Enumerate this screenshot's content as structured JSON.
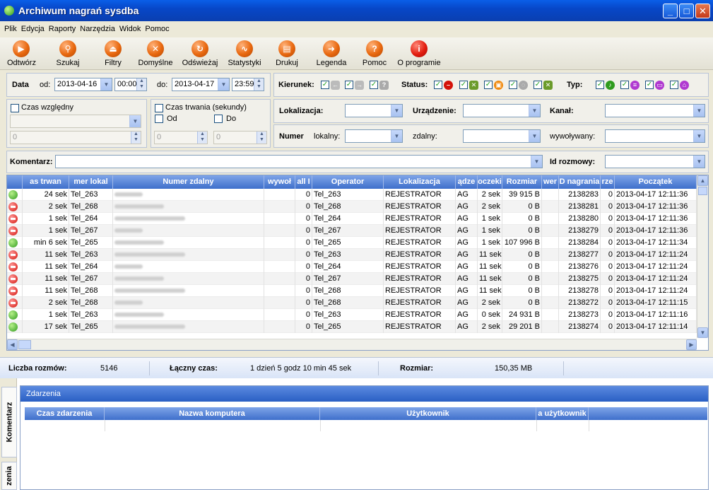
{
  "window": {
    "title": "Archiwum nagrań sysdba"
  },
  "menu": [
    "Plik",
    "Edycja",
    "Raporty",
    "Narzędzia",
    "Widok",
    "Pomoc"
  ],
  "toolbar": [
    {
      "label": "Odtwórz",
      "icon": "play-icon"
    },
    {
      "label": "Szukaj",
      "icon": "search-icon"
    },
    {
      "label": "Filtry",
      "icon": "filter-icon"
    },
    {
      "label": "Domyślne",
      "icon": "defaults-icon"
    },
    {
      "label": "Odświeżaj",
      "icon": "refresh-icon"
    },
    {
      "label": "Statystyki",
      "icon": "stats-icon"
    },
    {
      "label": "Drukuj",
      "icon": "print-icon"
    },
    {
      "label": "Legenda",
      "icon": "legend-icon"
    },
    {
      "label": "Pomoc",
      "icon": "help-icon"
    },
    {
      "label": "O programie",
      "icon": "info-icon"
    }
  ],
  "filters": {
    "data_label": "Data",
    "od_label": "od:",
    "date_from": "2013-04-16",
    "time_from": "00:00",
    "do_label": "do:",
    "date_to": "2013-04-17",
    "time_to": "23:59",
    "kierunek_label": "Kierunek:",
    "status_label": "Status:",
    "typ_label": "Typ:",
    "czas_wzgledny": "Czas względny",
    "czas_trwania": "Czas trwania (sekundy)",
    "od_small": "Od",
    "do_small": "Do",
    "rel_value": "0",
    "dur_from": "0",
    "dur_to": "0",
    "lokalizacja_label": "Lokalizacja:",
    "urzadzenie_label": "Urządzenie:",
    "kanal_label": "Kanał:",
    "numer_label": "Numer",
    "lokalny_label": "lokalny:",
    "zdalny_label": "zdalny:",
    "wywolywany_label": "wywoływany:",
    "komentarz_label": "Komentarz:",
    "id_rozmowy_label": "Id rozmowy:"
  },
  "table": {
    "headers": [
      "",
      "as trwan",
      "mer lokal",
      "Numer zdalny",
      "wywoł",
      "all I",
      "Operator",
      "Lokalizacja",
      "ądze",
      "oczeki",
      "Rozmiar",
      "wer",
      "D nagrania",
      "rze",
      "Początek"
    ],
    "rows": [
      {
        "status": "ok",
        "cells": [
          "24 sek",
          "Tel_263",
          "",
          "",
          "0",
          "Tel_263",
          "REJESTRATOR",
          "AG",
          "2 sek",
          "39 915 B",
          "",
          "2138283",
          "0",
          "2013-04-17 12:11:36"
        ]
      },
      {
        "status": "no",
        "cells": [
          "2 sek",
          "Tel_268",
          "",
          "",
          "0",
          "Tel_268",
          "REJESTRATOR",
          "AG",
          "2 sek",
          "0 B",
          "",
          "2138281",
          "0",
          "2013-04-17 12:11:36"
        ]
      },
      {
        "status": "no",
        "cells": [
          "1 sek",
          "Tel_264",
          "",
          "",
          "0",
          "Tel_264",
          "REJESTRATOR",
          "AG",
          "1 sek",
          "0 B",
          "",
          "2138280",
          "0",
          "2013-04-17 12:11:36"
        ]
      },
      {
        "status": "no",
        "cells": [
          "1 sek",
          "Tel_267",
          "",
          "",
          "0",
          "Tel_267",
          "REJESTRATOR",
          "AG",
          "1 sek",
          "0 B",
          "",
          "2138279",
          "0",
          "2013-04-17 12:11:36"
        ]
      },
      {
        "status": "ok",
        "cells": [
          "min 6 sek",
          "Tel_265",
          "",
          "",
          "0",
          "Tel_265",
          "REJESTRATOR",
          "AG",
          "1 sek",
          "107 996 B",
          "",
          "2138284",
          "0",
          "2013-04-17 12:11:34"
        ]
      },
      {
        "status": "no",
        "cells": [
          "11 sek",
          "Tel_263",
          "",
          "",
          "0",
          "Tel_263",
          "REJESTRATOR",
          "AG",
          "11 sek",
          "0 B",
          "",
          "2138277",
          "0",
          "2013-04-17 12:11:24"
        ]
      },
      {
        "status": "no",
        "cells": [
          "11 sek",
          "Tel_264",
          "",
          "",
          "0",
          "Tel_264",
          "REJESTRATOR",
          "AG",
          "11 sek",
          "0 B",
          "",
          "2138276",
          "0",
          "2013-04-17 12:11:24"
        ]
      },
      {
        "status": "no",
        "cells": [
          "11 sek",
          "Tel_267",
          "",
          "",
          "0",
          "Tel_267",
          "REJESTRATOR",
          "AG",
          "11 sek",
          "0 B",
          "",
          "2138275",
          "0",
          "2013-04-17 12:11:24"
        ]
      },
      {
        "status": "no",
        "cells": [
          "11 sek",
          "Tel_268",
          "",
          "",
          "0",
          "Tel_268",
          "REJESTRATOR",
          "AG",
          "11 sek",
          "0 B",
          "",
          "2138278",
          "0",
          "2013-04-17 12:11:24"
        ]
      },
      {
        "status": "no",
        "cells": [
          "2 sek",
          "Tel_268",
          "",
          "",
          "0",
          "Tel_268",
          "REJESTRATOR",
          "AG",
          "2 sek",
          "0 B",
          "",
          "2138272",
          "0",
          "2013-04-17 12:11:15"
        ]
      },
      {
        "status": "ok",
        "cells": [
          "1 sek",
          "Tel_263",
          "",
          "",
          "0",
          "Tel_263",
          "REJESTRATOR",
          "AG",
          "0 sek",
          "24 931 B",
          "",
          "2138273",
          "0",
          "2013-04-17 12:11:16"
        ]
      },
      {
        "status": "ok",
        "cells": [
          "17 sek",
          "Tel_265",
          "",
          "",
          "0",
          "Tel_265",
          "REJESTRATOR",
          "AG",
          "2 sek",
          "29 201 B",
          "",
          "2138274",
          "0",
          "2013-04-17 12:11:14"
        ]
      }
    ]
  },
  "status": {
    "liczba_label": "Liczba rozmów:",
    "liczba_value": "5146",
    "laczny_label": "Łączny czas:",
    "laczny_value": "1 dzień 5 godz 10 min 45 sek",
    "rozmiar_label": "Rozmiar:",
    "rozmiar_value": "150,35 MB"
  },
  "bottom": {
    "tab_komentarz": "Komentarz",
    "tab_zdarzenia": "zenia",
    "events_title": "Zdarzenia",
    "headers": [
      "Czas zdarzenia",
      "Nazwa komputera",
      "Użytkownik",
      "a użytkownik"
    ]
  }
}
